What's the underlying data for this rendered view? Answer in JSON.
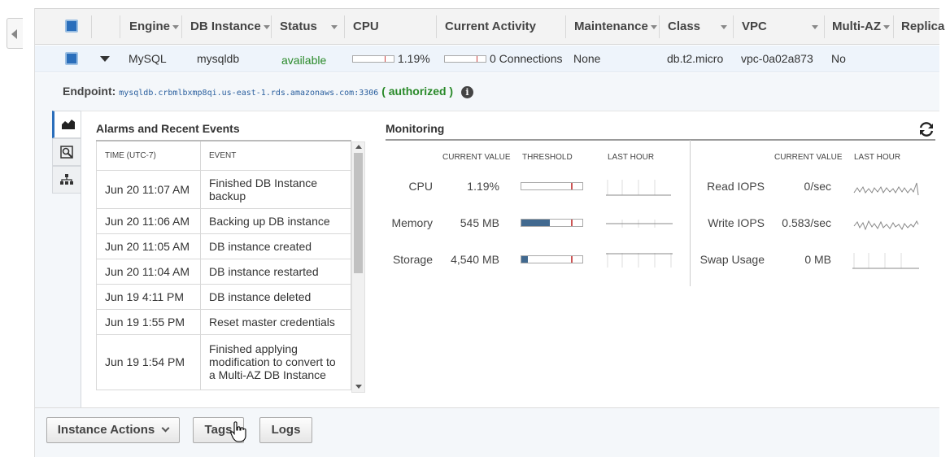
{
  "table": {
    "columns": [
      {
        "label": "Engine"
      },
      {
        "label": "DB Instance"
      },
      {
        "label": "Status"
      },
      {
        "label": "CPU"
      },
      {
        "label": "Current Activity"
      },
      {
        "label": "Maintenance"
      },
      {
        "label": "Class"
      },
      {
        "label": "VPC"
      },
      {
        "label": "Multi-AZ"
      },
      {
        "label": "Replica"
      }
    ],
    "row": {
      "engine": "MySQL",
      "db_instance": "mysqldb",
      "status": "available",
      "cpu": "1.19%",
      "cpu_bar_fraction": 0.012,
      "current_activity": "0 Connections",
      "activity_bar_fraction": 0.0,
      "maintenance": "None",
      "class": "db.t2.micro",
      "vpc": "vpc-0a02a873",
      "multi_az": "No"
    }
  },
  "detail": {
    "endpoint_label": "Endpoint:",
    "endpoint_url": "mysqldb.crbmlbxmp8qi.us-east-1.rds.amazonaws.com:3306",
    "auth_open": "(",
    "auth_text": "authorized",
    "auth_close": ")",
    "tabs": [
      "monitoring-chart-icon",
      "search-icon",
      "hierarchy-icon"
    ],
    "alarms": {
      "title": "Alarms and Recent Events",
      "col_time": "TIME (UTC-7)",
      "col_event": "EVENT",
      "rows": [
        {
          "time": "Jun 20 11:07 AM",
          "event": "Finished DB Instance backup"
        },
        {
          "time": "Jun 20 11:06 AM",
          "event": "Backing up DB instance"
        },
        {
          "time": "Jun 20 11:05 AM",
          "event": "DB instance created"
        },
        {
          "time": "Jun 20 11:04 AM",
          "event": "DB instance restarted"
        },
        {
          "time": "Jun 19 4:11 PM",
          "event": "DB instance deleted"
        },
        {
          "time": "Jun 19 1:55 PM",
          "event": "Reset master credentials"
        },
        {
          "time": "Jun 19 1:54 PM",
          "event": "Finished applying modification to convert to a Multi-AZ DB Instance"
        }
      ]
    },
    "monitoring": {
      "title": "Monitoring",
      "headers": {
        "current_value": "CURRENT VALUE",
        "threshold": "THRESHOLD",
        "last_hour": "LAST HOUR"
      },
      "left_metrics": [
        {
          "label": "CPU",
          "value": "1.19%",
          "threshold_fill": 0.0
        },
        {
          "label": "Memory",
          "value": "545 MB",
          "threshold_fill": 0.47
        },
        {
          "label": "Storage",
          "value": "4,540 MB",
          "threshold_fill": 0.1
        }
      ],
      "right_metrics": [
        {
          "label": "Read IOPS",
          "value": "0/sec"
        },
        {
          "label": "Write IOPS",
          "value": "0.583/sec"
        },
        {
          "label": "Swap Usage",
          "value": "0 MB"
        }
      ]
    }
  },
  "buttons": {
    "instance_actions": "Instance Actions",
    "tags": "Tags",
    "logs": "Logs"
  },
  "colors": {
    "accent": "#2a6ebb",
    "status_ok": "#2a8a2a",
    "threshold_fill": "#41698f"
  }
}
